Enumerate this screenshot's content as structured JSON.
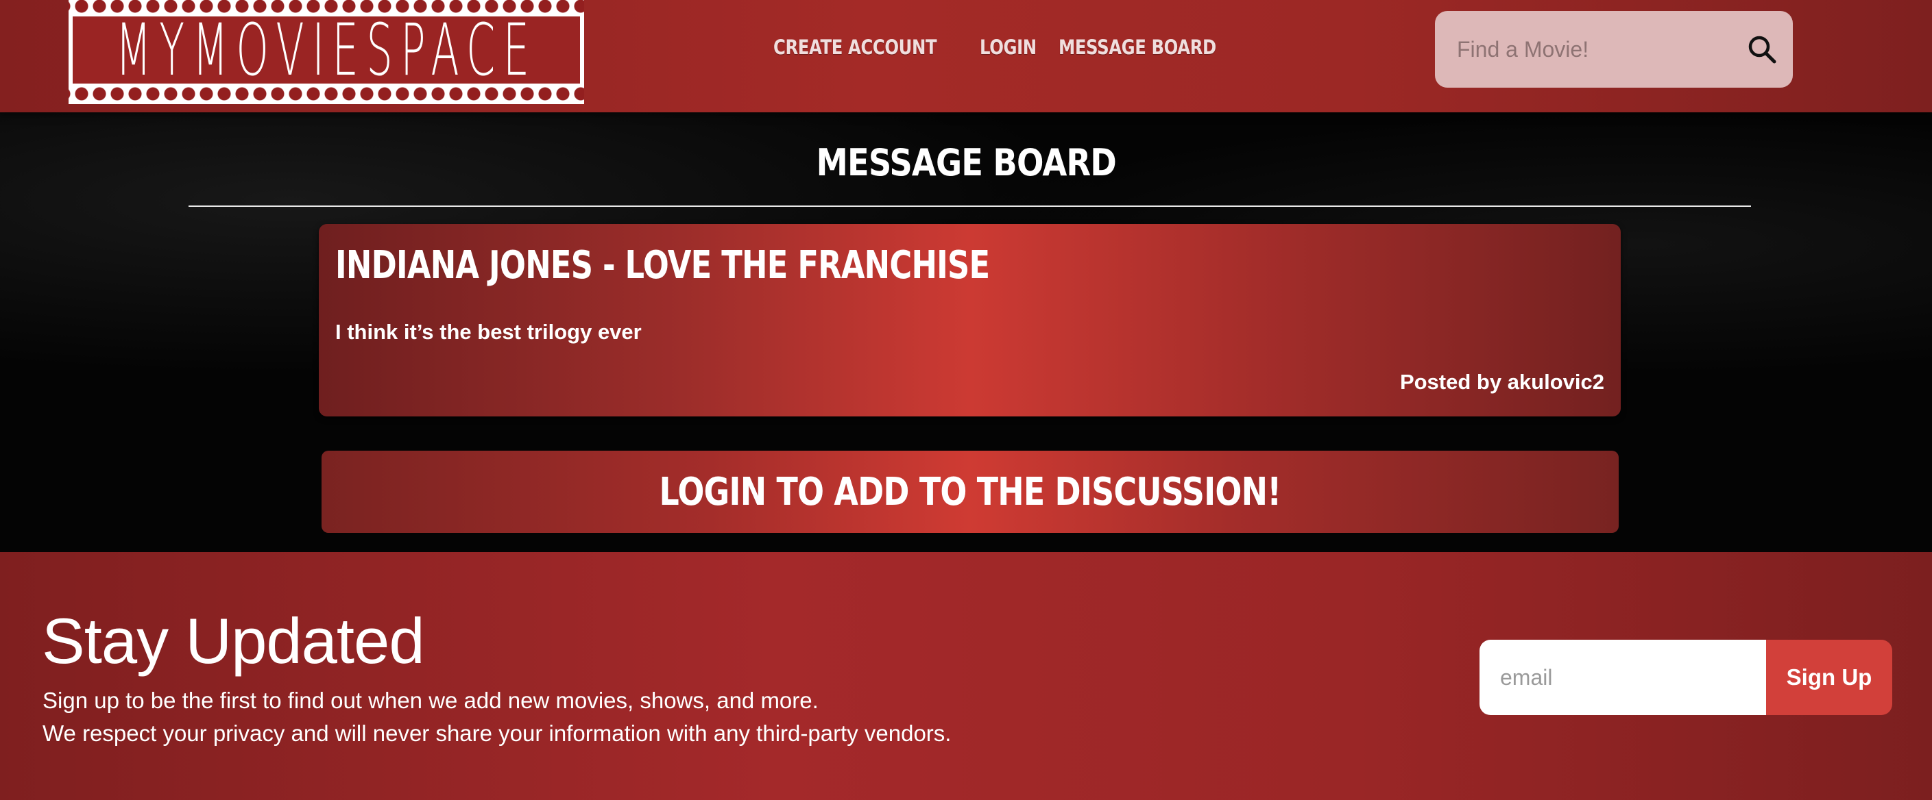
{
  "header": {
    "logo_text": "MYMOVIESPACE",
    "nav": [
      {
        "label": "CREATE ACCOUNT"
      },
      {
        "label": "LOGIN"
      },
      {
        "label": "MESSAGE BOARD"
      }
    ],
    "search": {
      "placeholder": "Find a Movie!",
      "value": "",
      "icon": "search-icon"
    }
  },
  "main": {
    "title": "MESSAGE BOARD",
    "posts": [
      {
        "title": "INDIANA JONES - LOVE THE FRANCHISE",
        "body": "I think it’s the best trilogy ever",
        "author_line": "Posted by akulovic2"
      }
    ],
    "login_prompt": "LOGIN TO ADD TO THE DISCUSSION!"
  },
  "footer": {
    "title": "Stay Updated",
    "line1": "Sign up to be the first to find out when we add new movies, shows, and more.",
    "line2": "We respect your privacy and will never share your information with any third-party vendors.",
    "email_placeholder": "email",
    "signup_label": "Sign Up"
  },
  "colors": {
    "brand_red": "#a4292a",
    "accent_red": "#d2403a",
    "search_bg": "#ddb8b8",
    "background": "#040404"
  }
}
